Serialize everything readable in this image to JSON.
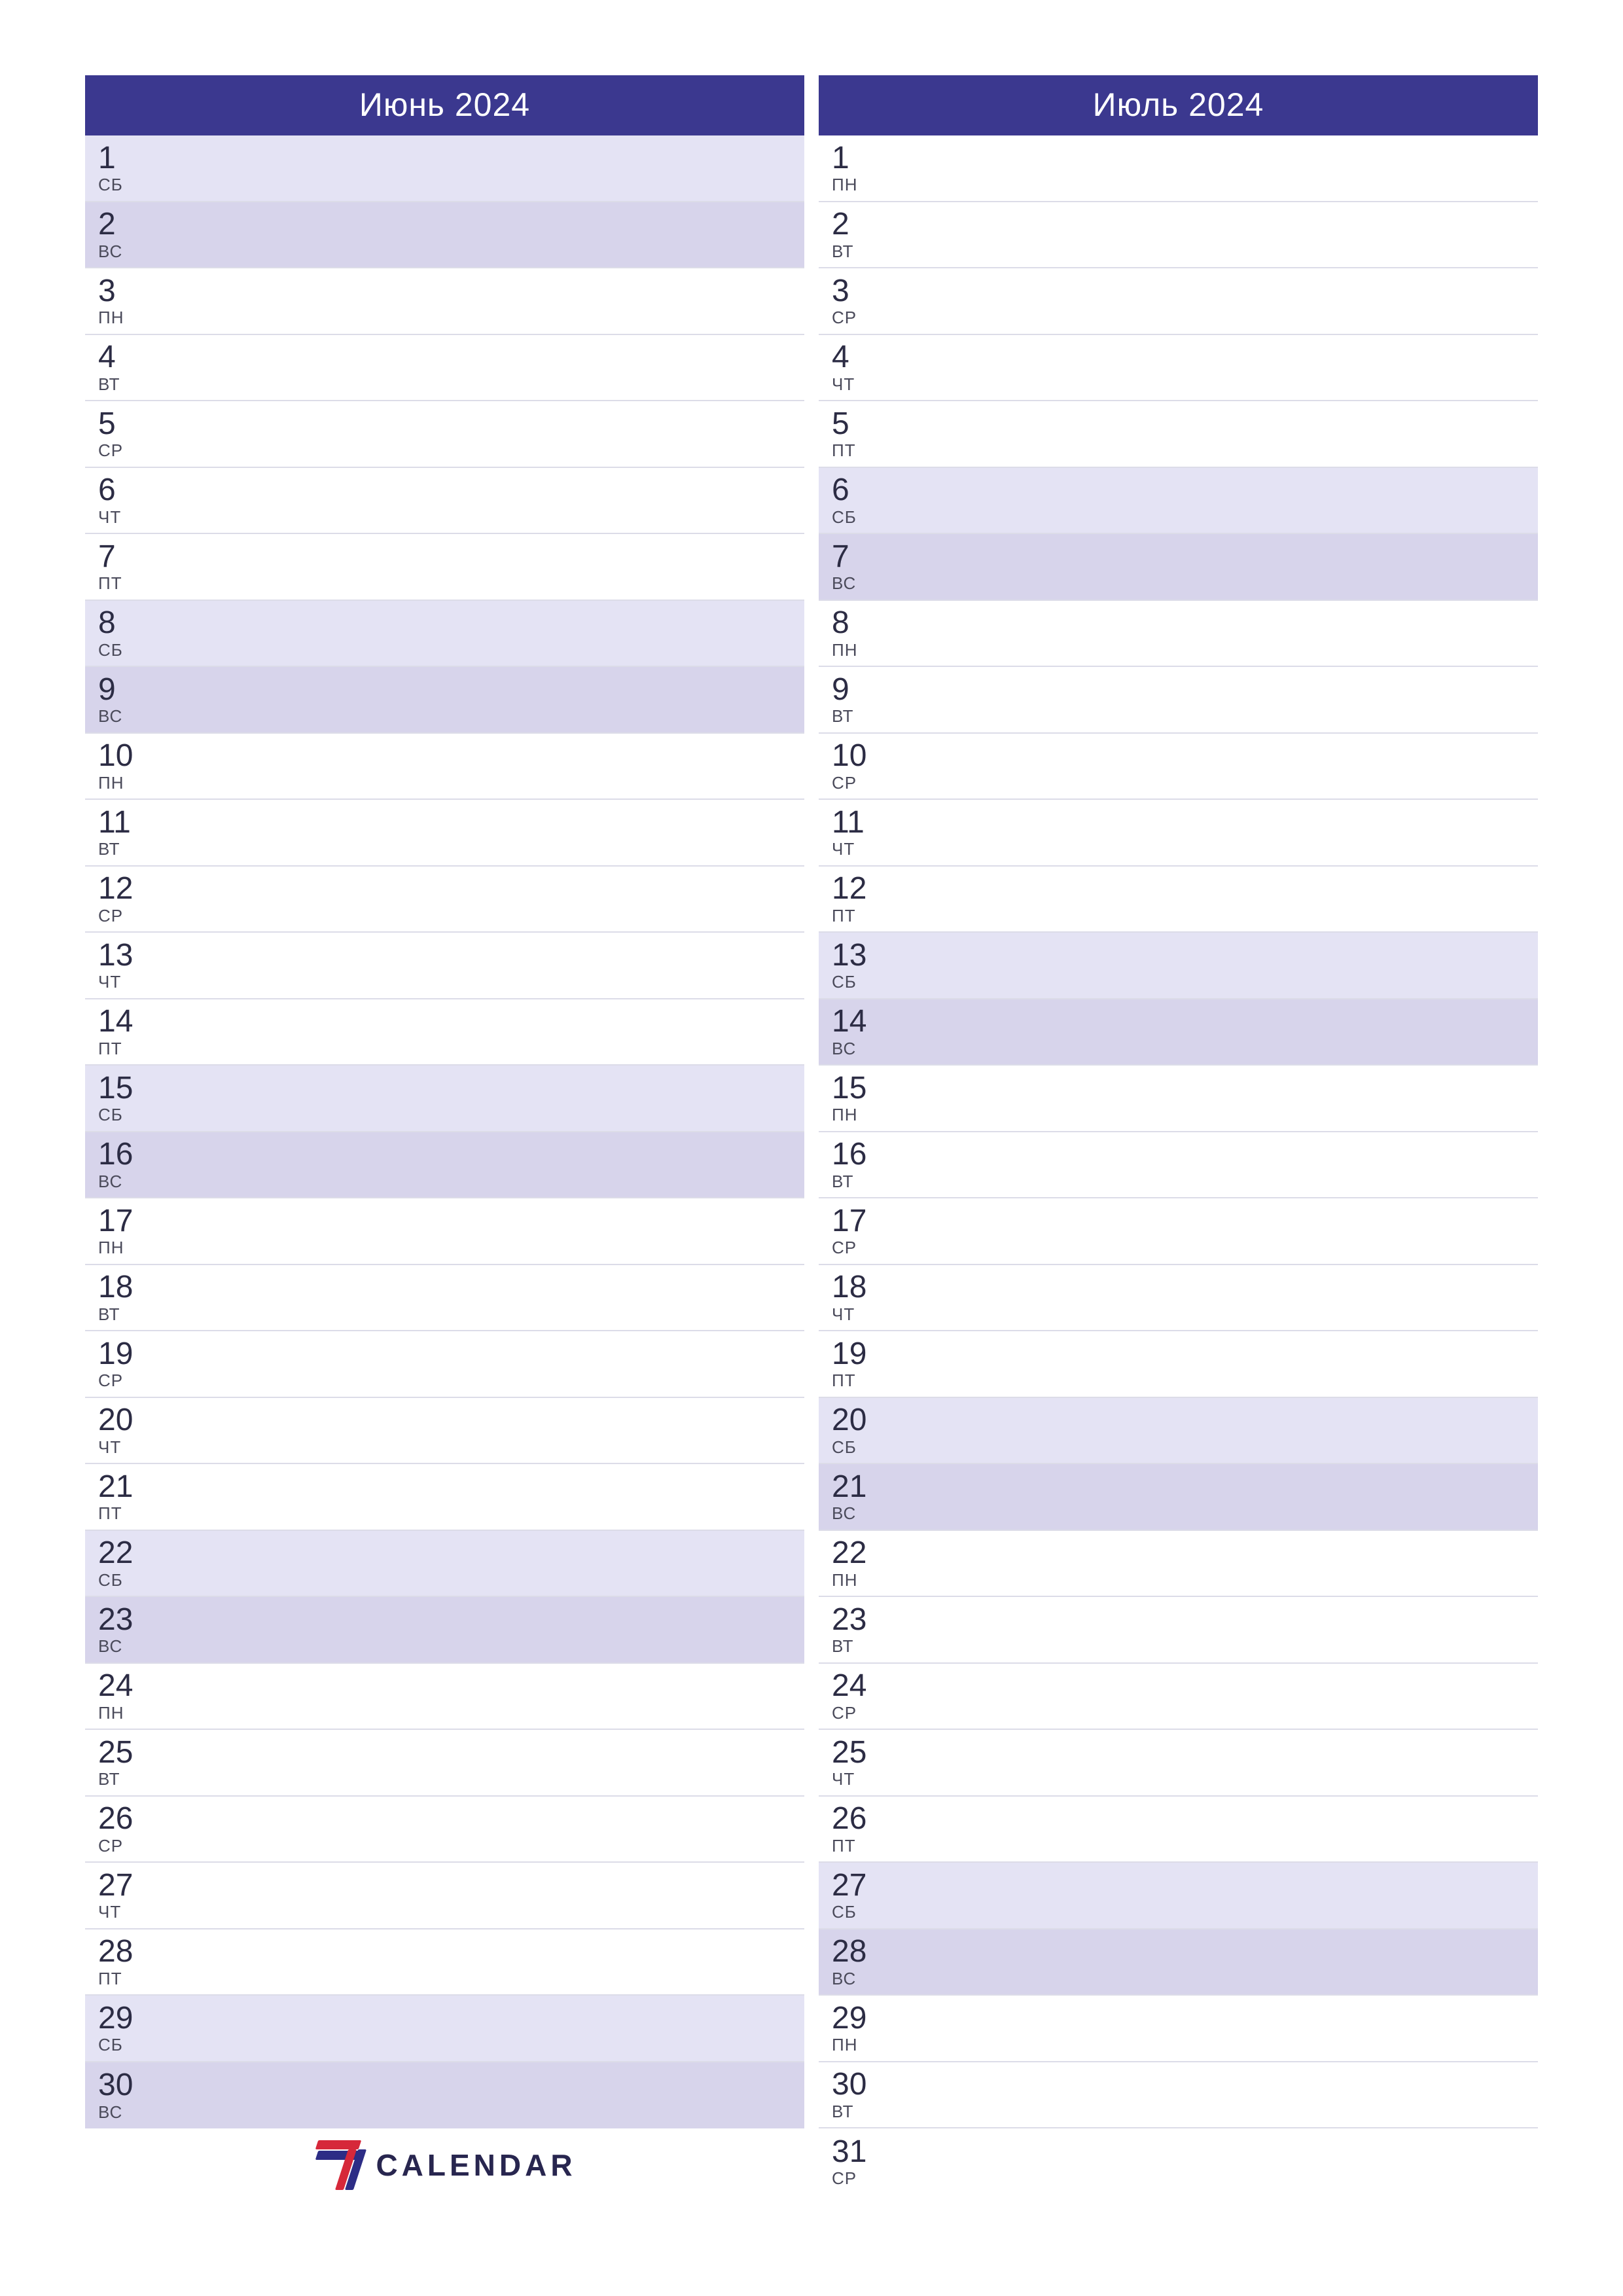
{
  "brand": {
    "text": "CALENDAR"
  },
  "dow": {
    "mon": "ПН",
    "tue": "ВТ",
    "wed": "СР",
    "thu": "ЧТ",
    "fri": "ПТ",
    "sat": "СБ",
    "sun": "ВС"
  },
  "bgcls": {
    "wk": "bg-wk",
    "sat": "bg-sat",
    "sun": "bg-sun"
  },
  "months": [
    {
      "title": "Июнь 2024",
      "days": [
        {
          "n": "1",
          "d": "sat"
        },
        {
          "n": "2",
          "d": "sun"
        },
        {
          "n": "3",
          "d": "mon"
        },
        {
          "n": "4",
          "d": "tue"
        },
        {
          "n": "5",
          "d": "wed"
        },
        {
          "n": "6",
          "d": "thu"
        },
        {
          "n": "7",
          "d": "fri"
        },
        {
          "n": "8",
          "d": "sat"
        },
        {
          "n": "9",
          "d": "sun"
        },
        {
          "n": "10",
          "d": "mon"
        },
        {
          "n": "11",
          "d": "tue"
        },
        {
          "n": "12",
          "d": "wed"
        },
        {
          "n": "13",
          "d": "thu"
        },
        {
          "n": "14",
          "d": "fri"
        },
        {
          "n": "15",
          "d": "sat"
        },
        {
          "n": "16",
          "d": "sun"
        },
        {
          "n": "17",
          "d": "mon"
        },
        {
          "n": "18",
          "d": "tue"
        },
        {
          "n": "19",
          "d": "wed"
        },
        {
          "n": "20",
          "d": "thu"
        },
        {
          "n": "21",
          "d": "fri"
        },
        {
          "n": "22",
          "d": "sat"
        },
        {
          "n": "23",
          "d": "sun"
        },
        {
          "n": "24",
          "d": "mon"
        },
        {
          "n": "25",
          "d": "tue"
        },
        {
          "n": "26",
          "d": "wed"
        },
        {
          "n": "27",
          "d": "thu"
        },
        {
          "n": "28",
          "d": "fri"
        },
        {
          "n": "29",
          "d": "sat"
        },
        {
          "n": "30",
          "d": "sun"
        }
      ]
    },
    {
      "title": "Июль 2024",
      "days": [
        {
          "n": "1",
          "d": "mon"
        },
        {
          "n": "2",
          "d": "tue"
        },
        {
          "n": "3",
          "d": "wed"
        },
        {
          "n": "4",
          "d": "thu"
        },
        {
          "n": "5",
          "d": "fri"
        },
        {
          "n": "6",
          "d": "sat"
        },
        {
          "n": "7",
          "d": "sun"
        },
        {
          "n": "8",
          "d": "mon"
        },
        {
          "n": "9",
          "d": "tue"
        },
        {
          "n": "10",
          "d": "wed"
        },
        {
          "n": "11",
          "d": "thu"
        },
        {
          "n": "12",
          "d": "fri"
        },
        {
          "n": "13",
          "d": "sat"
        },
        {
          "n": "14",
          "d": "sun"
        },
        {
          "n": "15",
          "d": "mon"
        },
        {
          "n": "16",
          "d": "tue"
        },
        {
          "n": "17",
          "d": "wed"
        },
        {
          "n": "18",
          "d": "thu"
        },
        {
          "n": "19",
          "d": "fri"
        },
        {
          "n": "20",
          "d": "sat"
        },
        {
          "n": "21",
          "d": "sun"
        },
        {
          "n": "22",
          "d": "mon"
        },
        {
          "n": "23",
          "d": "tue"
        },
        {
          "n": "24",
          "d": "wed"
        },
        {
          "n": "25",
          "d": "thu"
        },
        {
          "n": "26",
          "d": "fri"
        },
        {
          "n": "27",
          "d": "sat"
        },
        {
          "n": "28",
          "d": "sun"
        },
        {
          "n": "29",
          "d": "mon"
        },
        {
          "n": "30",
          "d": "tue"
        },
        {
          "n": "31",
          "d": "wed"
        }
      ]
    }
  ]
}
